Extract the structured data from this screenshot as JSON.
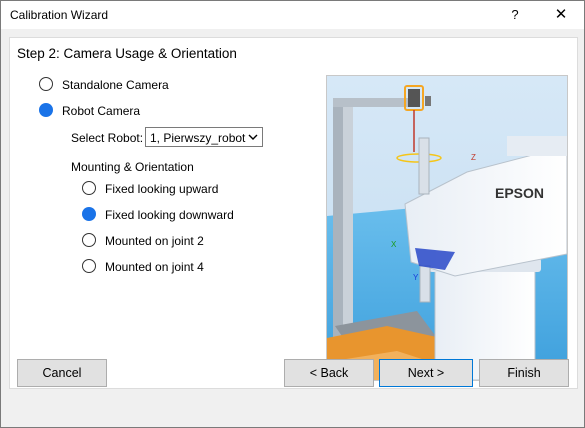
{
  "window": {
    "title": "Calibration Wizard",
    "help_label": "?",
    "close_label": "✕"
  },
  "step": {
    "title": "Step 2: Camera Usage & Orientation"
  },
  "camera_type": {
    "options": [
      {
        "label": "Standalone Camera",
        "checked": false
      },
      {
        "label": "Robot Camera",
        "checked": true
      }
    ]
  },
  "robot": {
    "label": "Select Robot:",
    "selected": "1, Pierwszy_robot"
  },
  "mounting": {
    "heading": "Mounting & Orientation",
    "options": [
      {
        "label": "Fixed looking upward",
        "checked": false
      },
      {
        "label": "Fixed looking downward",
        "checked": true
      },
      {
        "label": "Mounted on joint 2",
        "checked": false
      },
      {
        "label": "Mounted on joint 4",
        "checked": false
      }
    ]
  },
  "preview": {
    "brand_text": "EPSON",
    "axis_x": "X",
    "axis_y": "Y",
    "axis_z": "Z"
  },
  "buttons": {
    "cancel": "Cancel",
    "back": "< Back",
    "next": "Next >",
    "finish": "Finish"
  },
  "colors": {
    "accent": "#1a73e8",
    "camera_orange": "#f5a623",
    "floor_orange": "#e8952e",
    "scene_sky": "#cfe3f5",
    "scene_floor": "#5fb0e6"
  }
}
